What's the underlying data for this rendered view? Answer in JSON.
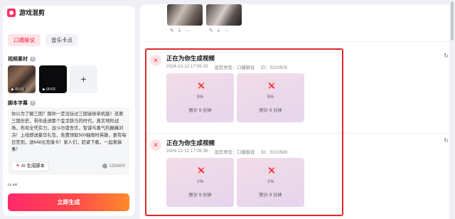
{
  "left": {
    "title": "游戏混剪",
    "tabs": [
      {
        "label": "口播解说",
        "active": true
      },
      {
        "label": "音乐卡点",
        "active": false
      }
    ],
    "materials_label": "视频素材",
    "thumbs": [
      {
        "duration": "▶ 00:31"
      },
      {
        "duration": "▶ 00:53"
      }
    ],
    "add_label": "+",
    "script_label": "脚本字幕",
    "script_text": "你以为了解三国？那你一定没玩过三国谜侯单机版！还原三国历史，带你走进那个金戈铁马的时代。真实地形战场，布局全凭实力，战斗尔虞吾诈，智谋与勇气的巅峰对决！上线即送豪华礼包，免费领取500抽限时英雄，更有每日签到，送648元充值卡！家人们，赶紧下载，一起来搞事！",
    "ai_button": "AI 生成脚本",
    "char_count": "129/600",
    "small_label": "LL AU",
    "generate_button": "立即生成"
  },
  "right": {
    "items": [
      {
        "title": "正在为你生成视频",
        "timestamp": "2024-12-12 17:06:15",
        "type": "混剪类型：口播解说",
        "id": "ID：5210505",
        "cards": [
          {
            "progress": "5%",
            "eta": "预计 9 分钟"
          },
          {
            "progress": "5%",
            "eta": "预计 9 分钟"
          }
        ]
      },
      {
        "title": "正在为你生成视频",
        "timestamp": "2024-12-12 17:06:38",
        "type": "混剪类型：口播解说",
        "id": "ID：5210589",
        "cards": [
          {
            "progress": "1%",
            "eta": "预计 9 分钟"
          },
          {
            "progress": "1%",
            "eta": "预计 9 分钟"
          }
        ]
      }
    ]
  },
  "colors": {
    "accent": "#f0274d",
    "highlight_border": "#e02828"
  },
  "icons": [
    "help-icon",
    "add-icon",
    "ai-sparkle-icon",
    "counter-icon",
    "edit-icon",
    "download-icon",
    "more-icon",
    "generating-icon",
    "refresh-icon"
  ]
}
